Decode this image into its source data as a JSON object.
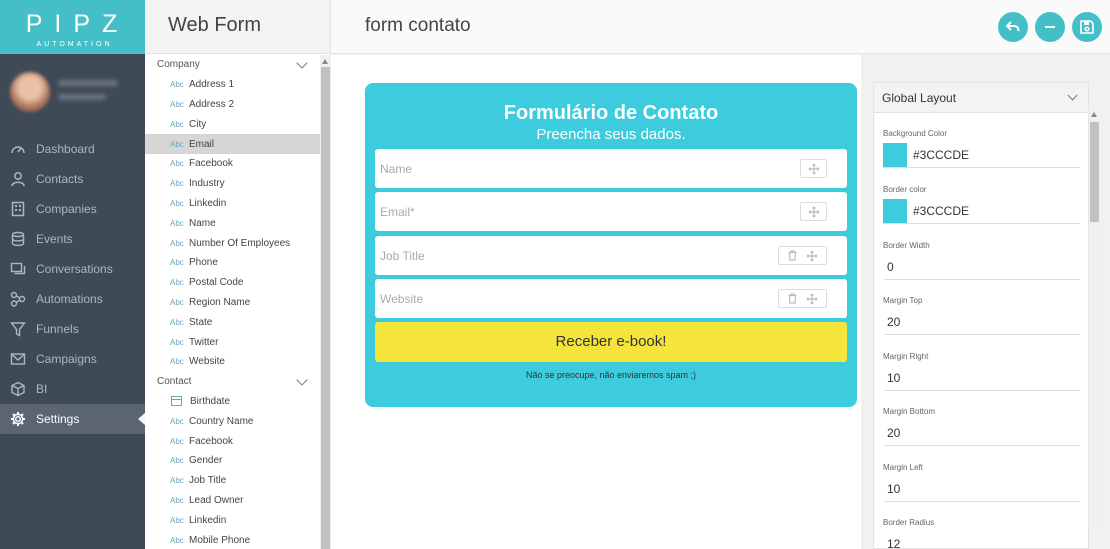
{
  "logo": {
    "word": "PIPZ",
    "sub": "AUTOMATION"
  },
  "profile": {
    "name_line1": "",
    "name_line2": ""
  },
  "nav": {
    "items": [
      {
        "label": "Dashboard",
        "icon": "dashboard-icon"
      },
      {
        "label": "Contacts",
        "icon": "user-icon"
      },
      {
        "label": "Companies",
        "icon": "building-icon"
      },
      {
        "label": "Events",
        "icon": "database-icon"
      },
      {
        "label": "Conversations",
        "icon": "chat-icon"
      },
      {
        "label": "Automations",
        "icon": "flow-icon"
      },
      {
        "label": "Funnels",
        "icon": "funnel-icon"
      },
      {
        "label": "Campaigns",
        "icon": "mail-icon"
      },
      {
        "label": "BI",
        "icon": "cube-icon"
      },
      {
        "label": "Settings",
        "icon": "gear-icon",
        "active": true
      }
    ]
  },
  "fields_panel": {
    "title": "Web Form",
    "abc": "Abc",
    "groups": [
      {
        "label": "Company",
        "items": [
          "Address 1",
          "Address 2",
          "City",
          "Email",
          "Facebook",
          "Industry",
          "Linkedin",
          "Name",
          "Number Of Employees",
          "Phone",
          "Postal Code",
          "Region Name",
          "State",
          "Twitter",
          "Website"
        ]
      },
      {
        "label": "Contact",
        "items": [
          "Birthdate",
          "Country Name",
          "Facebook",
          "Gender",
          "Job Title",
          "Lead Owner",
          "Linkedin",
          "Mobile Phone"
        ]
      }
    ]
  },
  "main": {
    "title": "form contato"
  },
  "form": {
    "title": "Formulário de Contato",
    "subtitle": "Preencha seus dados.",
    "fields": [
      {
        "placeholder": "Name"
      },
      {
        "placeholder": "Email*"
      },
      {
        "placeholder": "Job Title"
      },
      {
        "placeholder": "Website"
      }
    ],
    "submit_label": "Receber e-book!",
    "note": "Não se preocupe, não enviaremos spam ;)",
    "bg_color": "#3CCCDE",
    "button_color": "#F5E43A"
  },
  "layout_panel": {
    "title": "Global Layout",
    "background_color_label": "Background Color",
    "background_color": "#3CCCDE",
    "border_color_label": "Border color",
    "border_color": "#3CCCDE",
    "props": [
      {
        "label": "Border Width",
        "value": "0"
      },
      {
        "label": "Margin Top",
        "value": "20"
      },
      {
        "label": "Margin Right",
        "value": "10"
      },
      {
        "label": "Margin Bottom",
        "value": "20"
      },
      {
        "label": "Margin Left",
        "value": "10"
      },
      {
        "label": "Border Radius",
        "value": "12"
      }
    ]
  },
  "colors": {
    "accent": "#45BFC7",
    "nav_bg": "#3F4A57"
  }
}
